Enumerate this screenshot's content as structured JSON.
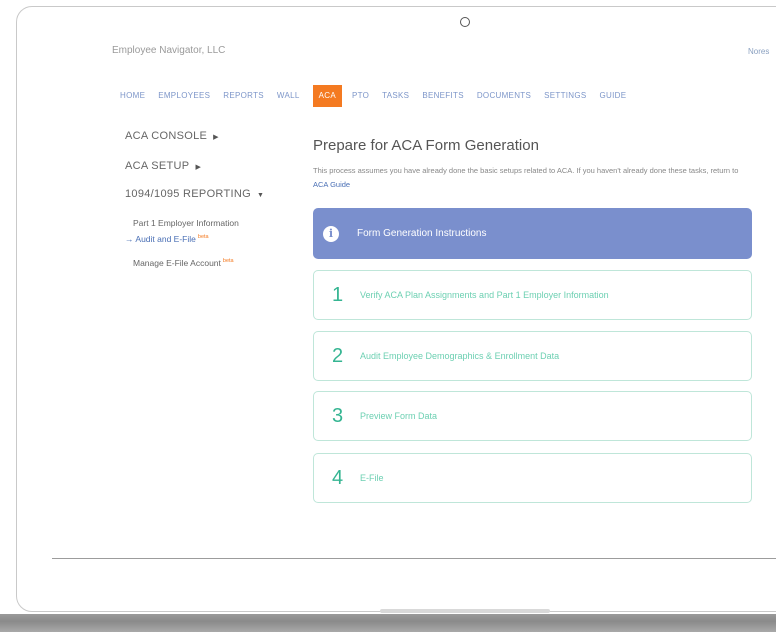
{
  "header": {
    "company": "Employee Navigator, LLC",
    "user": "Nores"
  },
  "nav": {
    "items": [
      {
        "label": "HOME"
      },
      {
        "label": "EMPLOYEES"
      },
      {
        "label": "REPORTS"
      },
      {
        "label": "WALL"
      },
      {
        "label": "ACA",
        "active": true
      },
      {
        "label": "PTO"
      },
      {
        "label": "TASKS"
      },
      {
        "label": "BENEFITS"
      },
      {
        "label": "DOCUMENTS"
      },
      {
        "label": "SETTINGS"
      },
      {
        "label": "GUIDE"
      }
    ]
  },
  "sidebar": {
    "aca_console": "ACA CONSOLE",
    "aca_setup": "ACA SETUP",
    "reporting": "1094/1095 REPORTING",
    "sub_items": [
      {
        "label": "Part 1 Employer Information"
      },
      {
        "arrow": "→",
        "label": "Audit and E-File",
        "badge": "beta"
      },
      {
        "label": "Manage E-File Account",
        "badge": "beta"
      }
    ]
  },
  "main": {
    "title": "Prepare for ACA Form Generation",
    "intro_text": "This process assumes you have already done the basic setups related to ACA. If you haven't already done these tasks, return to",
    "intro_link": "ACA Guide",
    "banner_label": "Form Generation Instructions",
    "banner_icon": "i",
    "steps": [
      {
        "number": "1",
        "label": "Verify ACA Plan Assignments and Part 1 Employer Information"
      },
      {
        "number": "2",
        "label": "Audit Employee Demographics & Enrollment Data"
      },
      {
        "number": "3",
        "label": "Preview Form Data"
      },
      {
        "number": "4",
        "label": "E-File"
      }
    ]
  }
}
